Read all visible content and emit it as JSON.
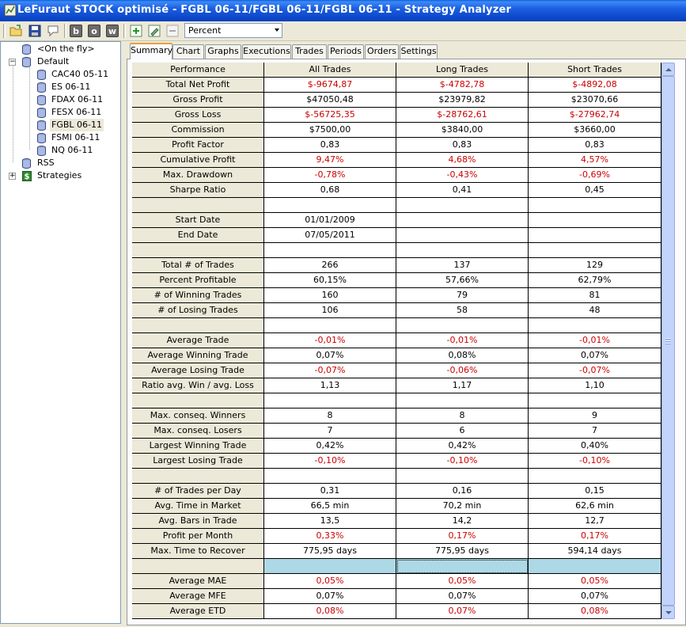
{
  "window": {
    "title": "LeFuraut STOCK optimisé - FGBL 06-11/FGBL 06-11/FGBL 06-11 - Strategy Analyzer"
  },
  "toolbar": {
    "letter_buttons": [
      "b",
      "o",
      "w"
    ],
    "display_mode": "Percent"
  },
  "tree": {
    "on_the_fly": "<On the fly>",
    "default": "Default",
    "instruments": [
      "CAC40 05-11",
      "ES 06-11",
      "FDAX 06-11",
      "FESX 06-11",
      "FGBL 06-11",
      "FSMI 06-11",
      "NQ 06-11"
    ],
    "selected": "FGBL 06-11",
    "rss": "RSS",
    "strategies": "Strategies"
  },
  "tabs": [
    "Summary",
    "Chart",
    "Graphs",
    "Executions",
    "Trades",
    "Periods",
    "Orders",
    "Settings"
  ],
  "active_tab": "Summary",
  "table": {
    "headers": [
      "Performance",
      "All Trades",
      "Long Trades",
      "Short Trades"
    ],
    "rows": [
      [
        "Total Net Profit",
        "$-9674,87",
        "$-4782,78",
        "$-4892,08"
      ],
      [
        "Gross Profit",
        "$47050,48",
        "$23979,82",
        "$23070,66"
      ],
      [
        "Gross Loss",
        "$-56725,35",
        "$-28762,61",
        "$-27962,74"
      ],
      [
        "Commission",
        "$7500,00",
        "$3840,00",
        "$3660,00"
      ],
      [
        "Profit Factor",
        "0,83",
        "0,83",
        "0,83"
      ],
      [
        "Cumulative Profit",
        "9,47%",
        "4,68%",
        "4,57%"
      ],
      [
        "Max. Drawdown",
        "-0,78%",
        "-0,43%",
        "-0,69%"
      ],
      [
        "Sharpe Ratio",
        "0,68",
        "0,41",
        "0,45"
      ],
      [
        "",
        "",
        "",
        ""
      ],
      [
        "Start Date",
        "01/01/2009",
        "",
        ""
      ],
      [
        "End Date",
        "07/05/2011",
        "",
        ""
      ],
      [
        "",
        "",
        "",
        ""
      ],
      [
        "Total # of Trades",
        "266",
        "137",
        "129"
      ],
      [
        "Percent Profitable",
        "60,15%",
        "57,66%",
        "62,79%"
      ],
      [
        "# of Winning Trades",
        "160",
        "79",
        "81"
      ],
      [
        "# of Losing Trades",
        "106",
        "58",
        "48"
      ],
      [
        "",
        "",
        "",
        ""
      ],
      [
        "Average Trade",
        "-0,01%",
        "-0,01%",
        "-0,01%"
      ],
      [
        "Average Winning Trade",
        "0,07%",
        "0,08%",
        "0,07%"
      ],
      [
        "Average Losing Trade",
        "-0,07%",
        "-0,06%",
        "-0,07%"
      ],
      [
        "Ratio avg. Win / avg. Loss",
        "1,13",
        "1,17",
        "1,10"
      ],
      [
        "",
        "",
        "",
        ""
      ],
      [
        "Max. conseq. Winners",
        "8",
        "8",
        "9"
      ],
      [
        "Max. conseq. Losers",
        "7",
        "6",
        "7"
      ],
      [
        "Largest Winning Trade",
        "0,42%",
        "0,42%",
        "0,40%"
      ],
      [
        "Largest Losing Trade",
        "-0,10%",
        "-0,10%",
        "-0,10%"
      ],
      [
        "",
        "",
        "",
        ""
      ],
      [
        "# of Trades per Day",
        "0,31",
        "0,16",
        "0,15"
      ],
      [
        "Avg. Time in Market",
        "66,5 min",
        "70,2 min",
        "62,6 min"
      ],
      [
        "Avg. Bars in Trade",
        "13,5",
        "14,2",
        "12,7"
      ],
      [
        "Profit per Month",
        "0,33%",
        "0,17%",
        "0,17%"
      ],
      [
        "Max. Time to Recover",
        "775,95 days",
        "775,95 days",
        "594,14 days"
      ],
      [
        "",
        "",
        "",
        ""
      ],
      [
        "Average MAE",
        "0,05%",
        "0,05%",
        "0,05%"
      ],
      [
        "Average MFE",
        "0,07%",
        "0,07%",
        "0,07%"
      ],
      [
        "Average ETD",
        "0,08%",
        "0,07%",
        "0,08%"
      ]
    ],
    "red_rows": [
      "Total Net Profit",
      "Gross Loss",
      "Cumulative Profit",
      "Max. Drawdown",
      "Average Trade",
      "Average Losing Trade",
      "Largest Losing Trade",
      "Profit per Month",
      "Average MAE",
      "Average ETD"
    ],
    "highlight_row": 32
  },
  "colors": {
    "negative": "#cc0000",
    "header_bg": "#ece9d8",
    "highlight_bg": "#add8e6",
    "titlebar": "#0b46c9"
  }
}
